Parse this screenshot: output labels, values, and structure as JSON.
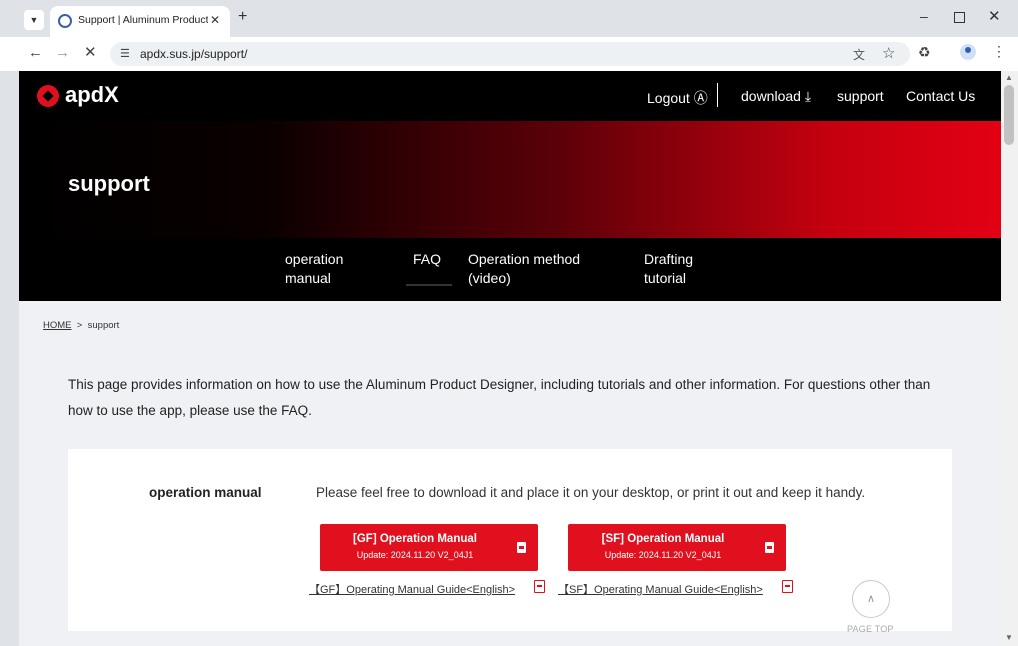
{
  "browser": {
    "tab_title": "Support | Aluminum Product Dé",
    "url": "apdx.sus.jp/support/",
    "icons": [
      "tab-list-icon",
      "favicon",
      "close-icon",
      "new-tab-icon",
      "minimize-icon",
      "maximize-icon",
      "window-close-icon",
      "back-icon",
      "forward-icon",
      "stop-icon",
      "site-info-icon",
      "translate-icon",
      "star-icon",
      "extensions-icon",
      "profile-icon",
      "menu-icon"
    ]
  },
  "header": {
    "logo": "apdX",
    "links": {
      "logout": "Logout Ⓐ",
      "download": "download ⤓",
      "support": "support",
      "contact": "Contact Us"
    }
  },
  "hero": {
    "title": "support"
  },
  "subnav": {
    "items": [
      "operation manual",
      "FAQ",
      "Operation method (video)",
      "Drafting tutorial"
    ],
    "items_lines": [
      [
        "operation",
        "manual"
      ],
      [
        "FAQ"
      ],
      [
        "Operation method",
        "(video)"
      ],
      [
        "Drafting",
        "tutorial"
      ]
    ]
  },
  "breadcrumb": {
    "home": "HOME",
    "separator": ">",
    "current": "support"
  },
  "intro": "This page provides information on how to use the Aluminum Product Designer, including tutorials and other information. For questions other than how to use the app, please use the FAQ.",
  "manual": {
    "label": "operation manual",
    "description": "Please feel free to download it and place it on your desktop, or print it out and keep it handy.",
    "buttons": [
      {
        "title": "[GF] Operation Manual",
        "update": "Update: 2024.11.20 V2_04J1"
      },
      {
        "title": "[SF] Operation Manual",
        "update": "Update: 2024.11.20 V2_04J1"
      }
    ],
    "guides": [
      "【GF】Operating Manual Guide<English>",
      "【SF】Operating Manual Guide<English>"
    ]
  },
  "page_top": {
    "arrow": "∧",
    "label": "PAGE TOP"
  },
  "colors": {
    "brand_red": "#e0101e",
    "header_black": "#000000",
    "page_bg": "#eff1f4"
  }
}
